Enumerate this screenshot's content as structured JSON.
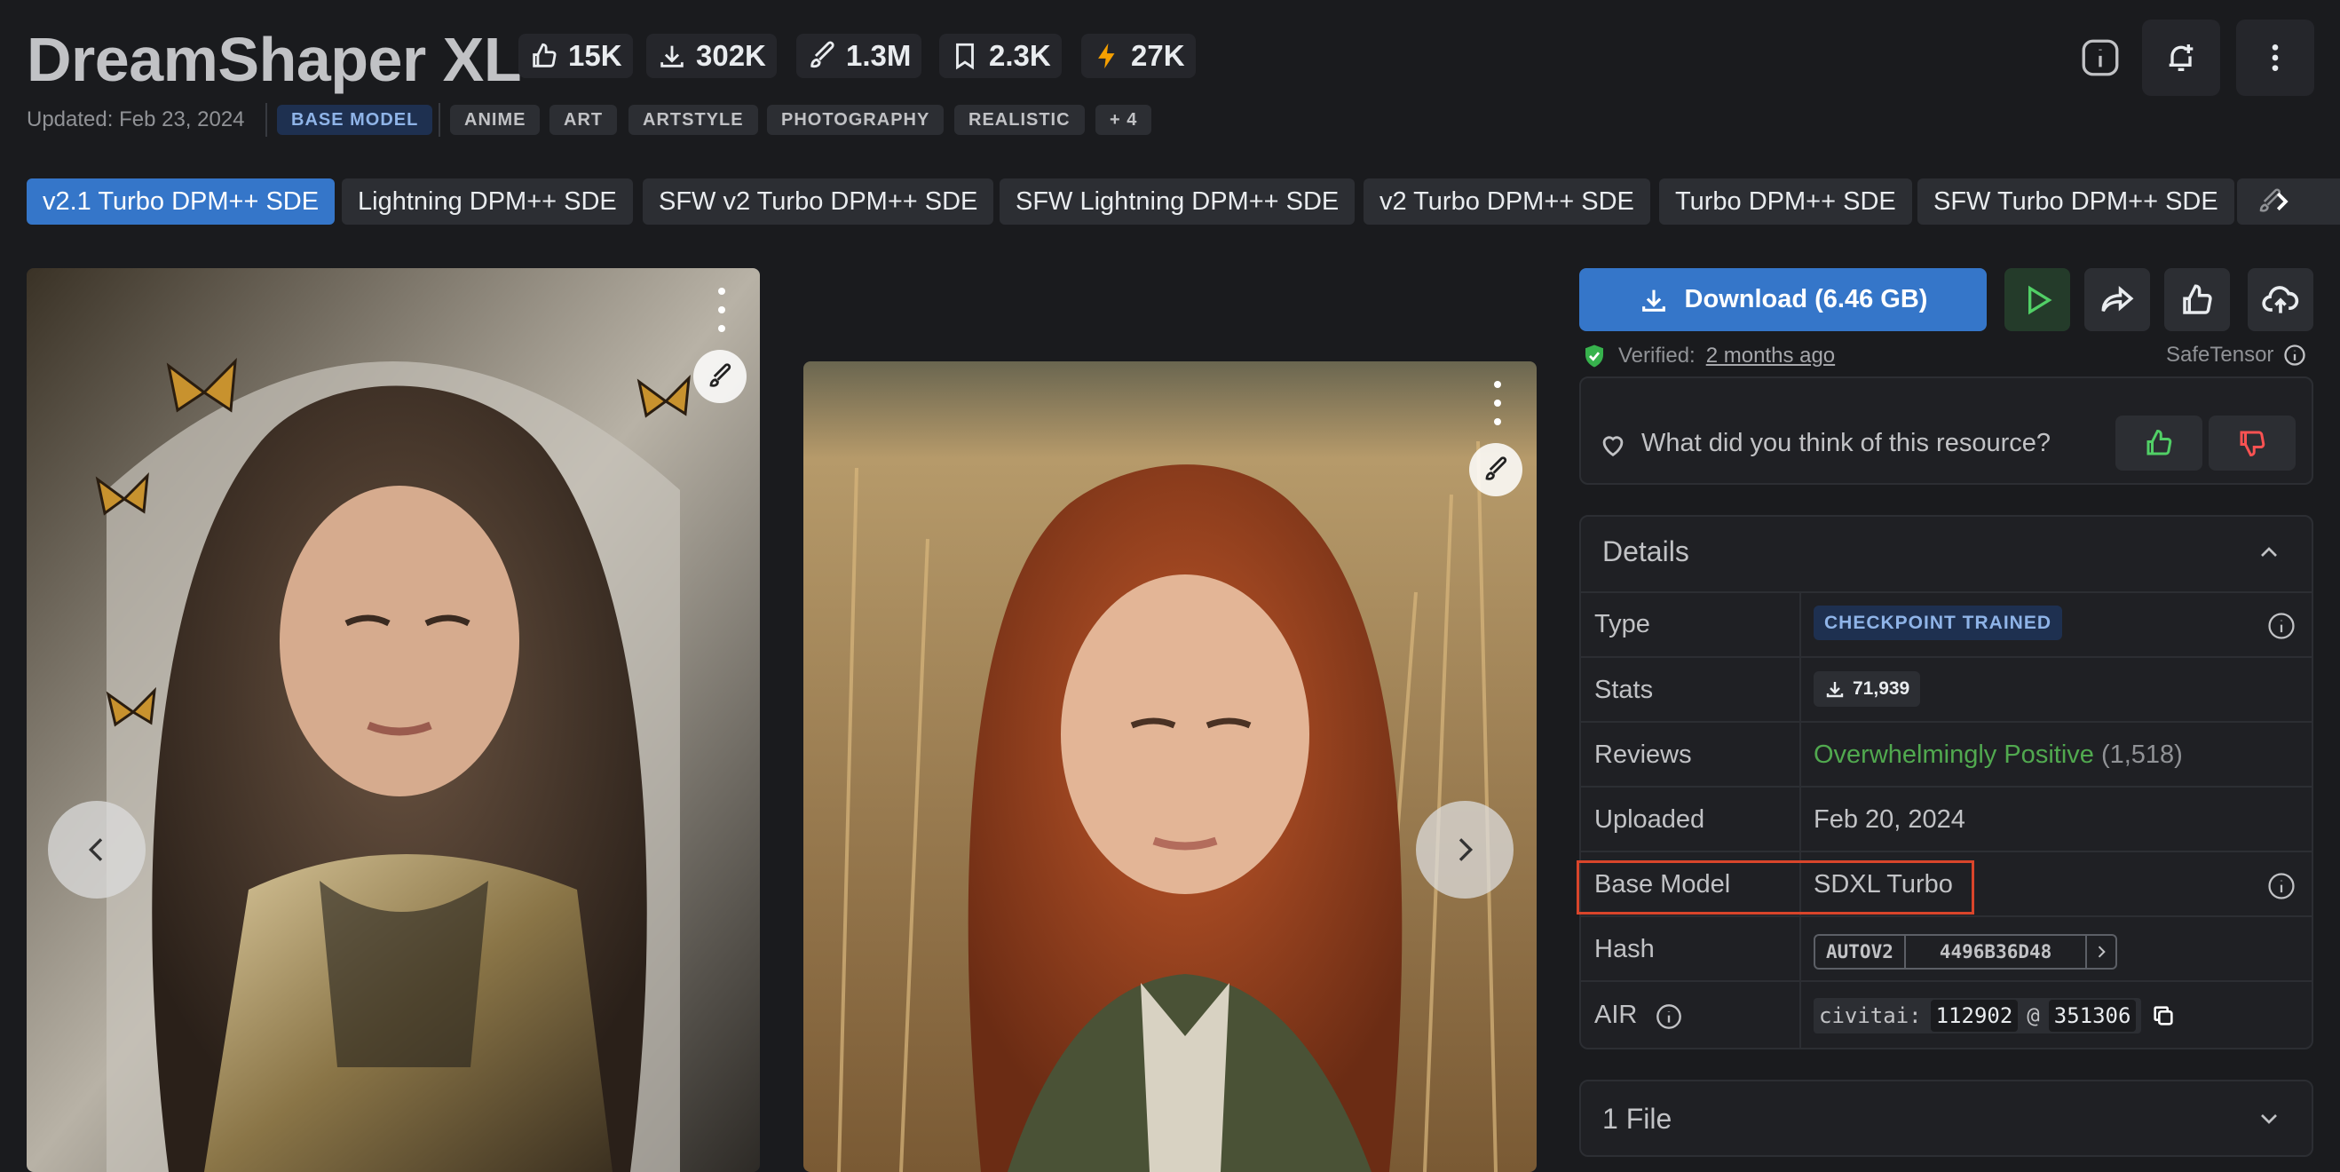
{
  "header": {
    "title": "DreamShaper XL",
    "stats": {
      "likes": "15K",
      "downloads": "302K",
      "generations": "1.3M",
      "bookmarks": "2.3K",
      "buzz": "27K"
    },
    "updated": "Updated: Feb 23, 2024",
    "base_tag": "BASE MODEL",
    "tags": [
      "ANIME",
      "ART",
      "ARTSTYLE",
      "PHOTOGRAPHY",
      "REALISTIC",
      "+ 4"
    ]
  },
  "versions": [
    "v2.1 Turbo DPM++ SDE",
    "Lightning DPM++ SDE",
    "SFW v2 Turbo DPM++ SDE",
    "SFW Lightning DPM++ SDE",
    "v2 Turbo DPM++ SDE",
    "Turbo DPM++ SDE",
    "SFW Turbo DPM++ SDE"
  ],
  "actions": {
    "download_label": "Download (6.46 GB)",
    "verified_prefix": "Verified:",
    "verified_time": "2 months ago",
    "safetensor": "SafeTensor"
  },
  "feedback": {
    "question": "What did you think of this resource?"
  },
  "details": {
    "title": "Details",
    "rows": {
      "type": {
        "label": "Type",
        "value": "CHECKPOINT TRAINED"
      },
      "stats": {
        "label": "Stats",
        "value": "71,939"
      },
      "reviews": {
        "label": "Reviews",
        "value": "Overwhelmingly Positive",
        "count": "(1,518)"
      },
      "uploaded": {
        "label": "Uploaded",
        "value": "Feb 20, 2024"
      },
      "base_model": {
        "label": "Base Model",
        "value": "SDXL Turbo"
      },
      "hash": {
        "label": "Hash",
        "algo": "AUTOV2",
        "value": "4496B36D48"
      },
      "air": {
        "label": "AIR",
        "prefix": "civitai:",
        "model_id": "112902",
        "at": "@",
        "version_id": "351306"
      }
    }
  },
  "files": {
    "title": "1 File"
  },
  "colors": {
    "accent": "#3576c9",
    "positive": "#51a94f",
    "highlight": "#d9452b"
  }
}
